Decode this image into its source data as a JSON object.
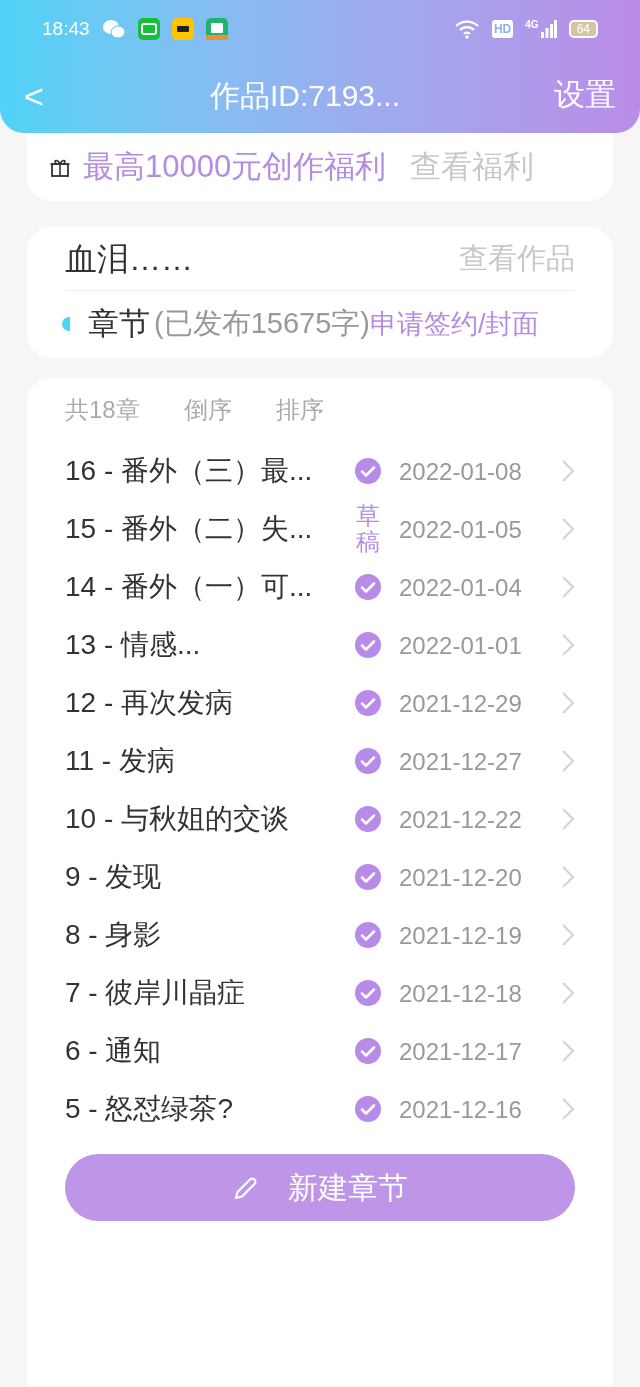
{
  "status_bar": {
    "time": "18:43",
    "hd": "HD",
    "network": "4G",
    "battery": "64"
  },
  "header": {
    "back": "<",
    "title": "作品ID:7193...",
    "settings": "设置"
  },
  "benefit": {
    "text": "最高10000元创作福利",
    "link": "查看福利"
  },
  "work": {
    "title": "血泪……",
    "view": "查看作品",
    "chapters_label": "章节",
    "published": "(已发布15675字)",
    "apply": "申请签约/封面"
  },
  "list_header": {
    "count": "共18章",
    "reverse": "倒序",
    "sort": "排序"
  },
  "chapters": [
    {
      "title": "16 - 番外（三）最...",
      "kind": "published",
      "date": "2022-01-08"
    },
    {
      "title": "15 - 番外（二）失...",
      "kind": "draft",
      "draft_label": "草稿",
      "date": "2022-01-05"
    },
    {
      "title": "14 - 番外（一）可...",
      "kind": "published",
      "date": "2022-01-04"
    },
    {
      "title": "13 - 情感...",
      "kind": "published",
      "date": "2022-01-01"
    },
    {
      "title": "12 - 再次发病",
      "kind": "published",
      "date": "2021-12-29"
    },
    {
      "title": "11 - 发病",
      "kind": "published",
      "date": "2021-12-27"
    },
    {
      "title": "10 - 与秋姐的交谈",
      "kind": "published",
      "date": "2021-12-22"
    },
    {
      "title": "9 - 发现",
      "kind": "published",
      "date": "2021-12-20"
    },
    {
      "title": "8 - 身影",
      "kind": "published",
      "date": "2021-12-19"
    },
    {
      "title": "7 - 彼岸川晶症",
      "kind": "published",
      "date": "2021-12-18"
    },
    {
      "title": "6 - 通知",
      "kind": "published",
      "date": "2021-12-17"
    },
    {
      "title": "5 - 怒怼绿茶?",
      "kind": "published",
      "date": "2021-12-16"
    }
  ],
  "new_chapter": "新建章节"
}
